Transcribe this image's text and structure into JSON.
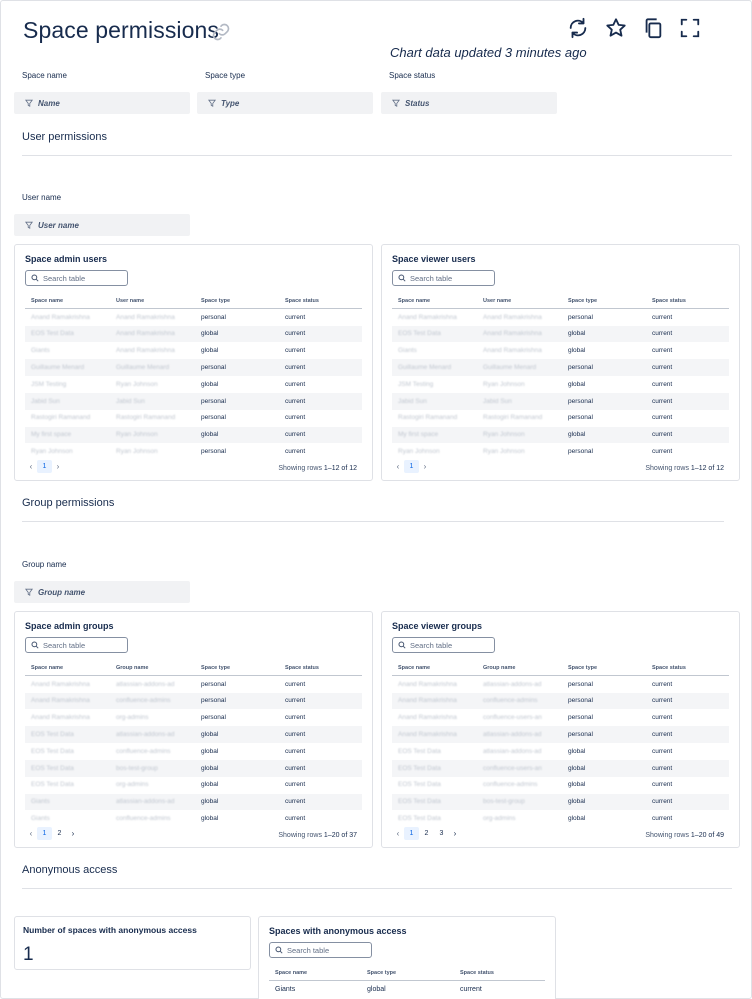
{
  "header": {
    "title": "Space permissions",
    "updated": "Chart data updated 3 minutes ago",
    "toolbar": [
      "refresh-icon",
      "star-icon",
      "copy-icon",
      "fullscreen-icon"
    ]
  },
  "filters_top": [
    {
      "label": "Space name",
      "placeholder": "Name"
    },
    {
      "label": "Space type",
      "placeholder": "Type"
    },
    {
      "label": "Space status",
      "placeholder": "Status"
    }
  ],
  "user_section": {
    "heading": "User permissions",
    "filter_label": "User name",
    "filter_placeholder": "User name"
  },
  "group_section": {
    "heading": "Group permissions",
    "filter_label": "Group name",
    "filter_placeholder": "Group name"
  },
  "anon_section": {
    "heading": "Anonymous access",
    "kpi_title": "Number of spaces with anonymous access",
    "kpi_value": "1"
  },
  "search_placeholder": "Search table",
  "tables": {
    "space_admin_users": {
      "title": "Space admin users",
      "columns": [
        "Space name",
        "User name",
        "Space type",
        "Space status"
      ],
      "rows": [
        [
          "Anand Ramakrishna",
          "Anand Ramakrishna",
          "personal",
          "current"
        ],
        [
          "EOS Test Data",
          "Anand Ramakrishna",
          "global",
          "current"
        ],
        [
          "Giants",
          "Anand Ramakrishna",
          "global",
          "current"
        ],
        [
          "Guillaume Menard",
          "Guillaume Menard",
          "personal",
          "current"
        ],
        [
          "JSM Testing",
          "Ryan Johnson",
          "global",
          "current"
        ],
        [
          "Jabid Sun",
          "Jabid Sun",
          "personal",
          "current"
        ],
        [
          "Rastogiri Ramanand",
          "Rastogiri Ramanand",
          "personal",
          "current"
        ],
        [
          "My first space",
          "Ryan Johnson",
          "global",
          "current"
        ],
        [
          "Ryan Johnson",
          "Ryan Johnson",
          "personal",
          "current"
        ]
      ],
      "pages": [
        "1"
      ],
      "showing_prefix": "Showing rows ",
      "showing_range": "1–12 of 12"
    },
    "space_viewer_users": {
      "title": "Space viewer users",
      "columns": [
        "Space name",
        "User name",
        "Space type",
        "Space status"
      ],
      "rows": [
        [
          "Anand Ramakrishna",
          "Anand Ramakrishna",
          "personal",
          "current"
        ],
        [
          "EOS Test Data",
          "Anand Ramakrishna",
          "global",
          "current"
        ],
        [
          "Giants",
          "Anand Ramakrishna",
          "global",
          "current"
        ],
        [
          "Guillaume Menard",
          "Guillaume Menard",
          "personal",
          "current"
        ],
        [
          "JSM Testing",
          "Ryan Johnson",
          "global",
          "current"
        ],
        [
          "Jabid Sun",
          "Jabid Sun",
          "personal",
          "current"
        ],
        [
          "Rastogiri Ramanand",
          "Rastogiri Ramanand",
          "personal",
          "current"
        ],
        [
          "My first space",
          "Ryan Johnson",
          "global",
          "current"
        ],
        [
          "Ryan Johnson",
          "Ryan Johnson",
          "personal",
          "current"
        ]
      ],
      "pages": [
        "1"
      ],
      "showing_prefix": "Showing rows ",
      "showing_range": "1–12 of 12"
    },
    "space_admin_groups": {
      "title": "Space admin groups",
      "columns": [
        "Space name",
        "Group name",
        "Space type",
        "Space status"
      ],
      "rows": [
        [
          "Anand Ramakrishna",
          "atlassian-addons-ad",
          "personal",
          "current"
        ],
        [
          "Anand Ramakrishna",
          "confluence-admins",
          "personal",
          "current"
        ],
        [
          "Anand Ramakrishna",
          "org-admins",
          "personal",
          "current"
        ],
        [
          "EOS Test Data",
          "atlassian-addons-ad",
          "global",
          "current"
        ],
        [
          "EOS Test Data",
          "confluence-admins",
          "global",
          "current"
        ],
        [
          "EOS Test Data",
          "bos-test-group",
          "global",
          "current"
        ],
        [
          "EOS Test Data",
          "org-admins",
          "global",
          "current"
        ],
        [
          "Giants",
          "atlassian-addons-ad",
          "global",
          "current"
        ],
        [
          "Giants",
          "confluence-admins",
          "global",
          "current"
        ]
      ],
      "pages": [
        "1",
        "2"
      ],
      "showing_prefix": "Showing rows ",
      "showing_range": "1–20 of 37"
    },
    "space_viewer_groups": {
      "title": "Space viewer groups",
      "columns": [
        "Space name",
        "Group name",
        "Space type",
        "Space status"
      ],
      "rows": [
        [
          "Anand Ramakrishna",
          "atlassian-addons-ad",
          "personal",
          "current"
        ],
        [
          "Anand Ramakrishna",
          "confluence-admins",
          "personal",
          "current"
        ],
        [
          "Anand Ramakrishna",
          "confluence-users-an",
          "personal",
          "current"
        ],
        [
          "Anand Ramakrishna",
          "atlassian-addons-ad",
          "personal",
          "current"
        ],
        [
          "EOS Test Data",
          "atlassian-addons-ad",
          "global",
          "current"
        ],
        [
          "EOS Test Data",
          "confluence-users-an",
          "global",
          "current"
        ],
        [
          "EOS Test Data",
          "confluence-admins",
          "global",
          "current"
        ],
        [
          "EOS Test Data",
          "bos-test-group",
          "global",
          "current"
        ],
        [
          "EOS Test Data",
          "org-admins",
          "global",
          "current"
        ]
      ],
      "pages": [
        "1",
        "2",
        "3"
      ],
      "showing_prefix": "Showing rows ",
      "showing_range": "1–20 of 49"
    },
    "anon_spaces": {
      "title": "Spaces with anonymous access",
      "columns": [
        "Space name",
        "Space type",
        "Space status"
      ],
      "rows": [
        [
          "Giants",
          "global",
          "current"
        ]
      ]
    }
  }
}
